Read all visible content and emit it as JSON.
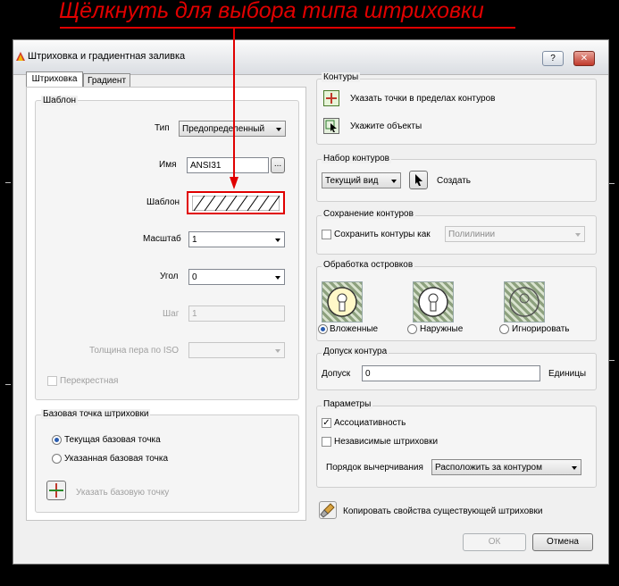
{
  "annotation": "Щёлкнуть для выбора типа штриховки",
  "dialog": {
    "title": "Штриховка и градиентная заливка",
    "help_label": "?",
    "close_label": "✕"
  },
  "tabs": [
    {
      "label": "Штриховка"
    },
    {
      "label": "Градиент"
    }
  ],
  "pattern": {
    "group_title": "Шаблон",
    "type_label": "Тип",
    "type_value": "Предопределенный",
    "name_label": "Имя",
    "name_value": "ANSI31",
    "browse_label": "...",
    "swatch_label": "Шаблон",
    "scale_label": "Масштаб",
    "scale_value": "1",
    "angle_label": "Угол",
    "angle_value": "0",
    "spacing_label": "Шаг",
    "spacing_value": "1",
    "iso_label": "Толщина пера по ISO",
    "iso_value": "",
    "cross_label": "Перекрестная"
  },
  "origin": {
    "group_title": "Базовая точка штриховки",
    "current_label": "Текущая базовая точка",
    "specified_label": "Указанная базовая точка",
    "pick_label": "Указать базовую точку"
  },
  "boundaries": {
    "group_title": "Контуры",
    "pick_points_label": "Указать точки в пределах контуров",
    "select_objects_label": "Укажите объекты"
  },
  "boundary_set": {
    "group_title": "Набор контуров",
    "value": "Текущий вид",
    "create_label": "Создать"
  },
  "retain": {
    "group_title": "Сохранение контуров",
    "checkbox_label": "Сохранить контуры как",
    "value": "Полилинии"
  },
  "islands": {
    "group_title": "Обработка островков",
    "options": [
      {
        "label": "Вложенные",
        "selected": true
      },
      {
        "label": "Наружные",
        "selected": false
      },
      {
        "label": "Игнорировать",
        "selected": false
      }
    ]
  },
  "tolerance": {
    "group_title": "Допуск контура",
    "label": "Допуск",
    "value": "0",
    "units_label": "Единицы"
  },
  "options": {
    "group_title": "Параметры",
    "associative_label": "Ассоциативность",
    "associative_checked": true,
    "separate_label": "Независимые штриховки",
    "separate_checked": false,
    "draw_order_label": "Порядок вычерчивания",
    "draw_order_value": "Расположить за контуром"
  },
  "inherit_label": "Копировать свойства существующей штриховки",
  "buttons": {
    "ok_label": "ОК",
    "cancel_label": "Отмена"
  }
}
